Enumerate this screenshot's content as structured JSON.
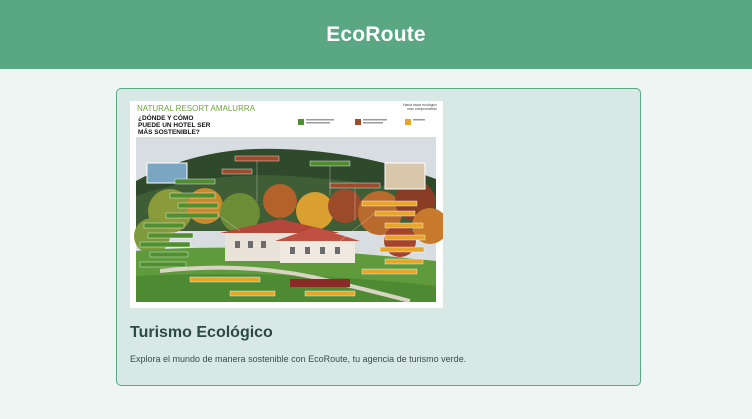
{
  "app": {
    "title": "EcoRoute"
  },
  "card": {
    "title": "Turismo Ecológico",
    "description": "Explora el mundo de manera sostenible con EcoRoute, tu agencia de turismo verde.",
    "image": {
      "poster_title": "NATURAL RESORT AMALURRA",
      "poster_subtitle": "¿DÓNDE Y CÓMO\nPUEDE UN HOTEL SER\nMÁS SOSTENIBLE?",
      "poster_topright": "Hacia hacia ecológico\nmás comprometido",
      "legend_colors": [
        "#4f8f2f",
        "#a04a2c",
        "#e8a628"
      ],
      "label_colors": [
        "#4f8f2f",
        "#a04a2c",
        "#e8a628"
      ]
    }
  },
  "colors": {
    "header_bg": "#5aa784",
    "page_bg": "#eef5f2",
    "card_bg": "#d8e9e5",
    "card_border": "#5aa784",
    "title_text": "#2c4a45"
  }
}
